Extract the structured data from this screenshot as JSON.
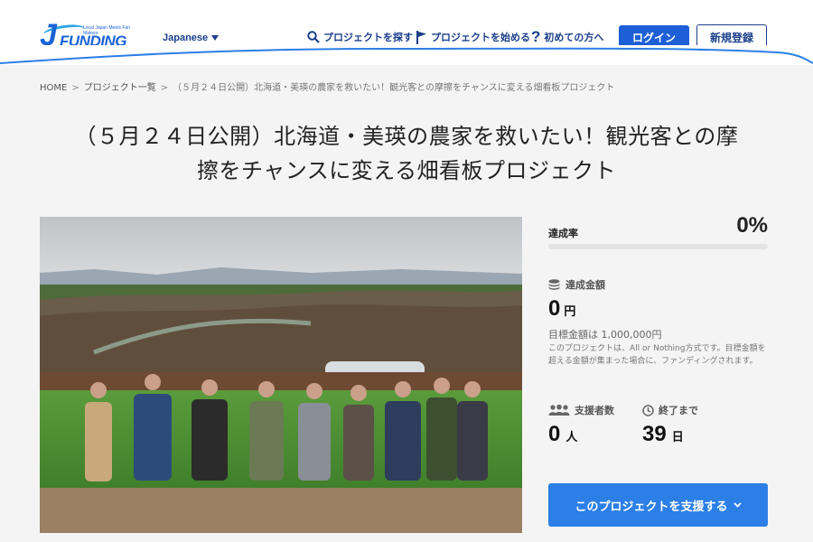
{
  "header": {
    "logo_text": "FUNDING",
    "logo_letter": "J",
    "logo_tagline": "Local Japan Meets Fan Makers",
    "language": "Japanese",
    "nav": {
      "search": "プロジェクトを探す",
      "start": "プロジェクトを始める",
      "help": "初めての方へ"
    },
    "login": "ログイン",
    "signup": "新規登録"
  },
  "breadcrumb": {
    "home": "HOME",
    "list": "プロジェクト一覧",
    "separator": ">",
    "current": "（５月２４日公開）北海道・美瑛の農家を救いたい！観光客との摩擦をチャンスに変える畑看板プロジェクト"
  },
  "title": {
    "line1": "（５月２４日公開）北海道・美瑛の農家を救いたい！観光客との摩",
    "line2": "擦をチャンスに変える畑看板プロジェクト"
  },
  "stats": {
    "rate_label": "達成率",
    "rate_value": "0%",
    "progress": 0,
    "amount_label": "達成金額",
    "amount_value": "0",
    "amount_unit": "円",
    "goal": "目標金額は 1,000,000円",
    "note": "このプロジェクトは、All or Nothing方式です。目標金額を超える金額が集まった場合に、ファンディングされます。",
    "backers_label": "支援者数",
    "backers_value": "0",
    "backers_unit": "人",
    "days_label": "終了まで",
    "days_value": "39",
    "days_unit": "日"
  },
  "support_button": "このプロジェクトを支援する",
  "colors": {
    "brand": "#1a63d6",
    "primary_button": "#1d5fd6",
    "support_button": "#2b7fe6",
    "nav_text": "#1a3f8a"
  }
}
